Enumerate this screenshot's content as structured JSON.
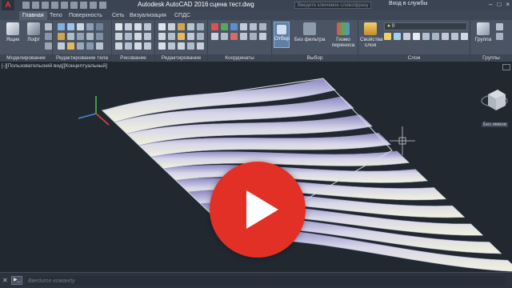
{
  "title": {
    "app_name": "Autodesk AutoCAD 2016",
    "document": "сцена тест.dwg",
    "search_placeholder": "Введите ключевое слово/фразу",
    "signin": "Вход в службы",
    "logo": "A",
    "window_buttons": [
      "–",
      "□",
      "×"
    ]
  },
  "tabs": [
    "Главная",
    "Тело",
    "Поверхность",
    "Сеть",
    "Визуализация",
    "СПДС"
  ],
  "ribbon": {
    "panels": {
      "modeling": "Моделирование",
      "solid_edit": "Редактирование тела",
      "draw": "Рисование",
      "modify": "Редактирование",
      "coordinates": "Координаты",
      "selection": "Выбор",
      "layers": "Слои",
      "groups": "Группы"
    },
    "buttons": {
      "box": "Ящик",
      "loft": "Лофт",
      "select": "Отбор",
      "no_filter": "Без фильтра",
      "gizmo": "Гизмо переноса",
      "layer_props": "Свойства слоя",
      "group": "Группа"
    },
    "dropdowns": {
      "no_name": "Без имени",
      "layer_value": "0"
    }
  },
  "viewport": {
    "label": "[-][Пользовательский вид][Концептуальный]",
    "viewcube_label": "Без имени"
  },
  "command": {
    "placeholder": "Введите команду",
    "prompt_icon": "▶_"
  },
  "colors": {
    "play_red": "#e23026",
    "surface": "#eceedd",
    "viewport_bg": "#212830"
  }
}
